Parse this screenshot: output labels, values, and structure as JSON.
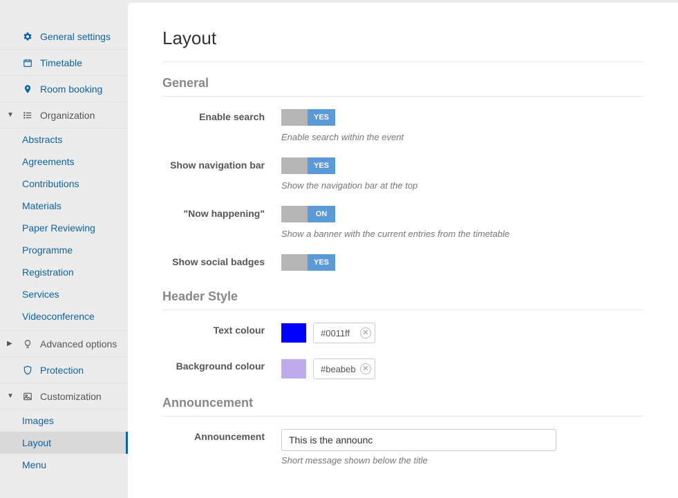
{
  "sidebar": {
    "general_settings": "General settings",
    "timetable": "Timetable",
    "room_booking": "Room booking",
    "organization": {
      "label": "Organization",
      "items": [
        "Abstracts",
        "Agreements",
        "Contributions",
        "Materials",
        "Paper Reviewing",
        "Programme",
        "Registration",
        "Services",
        "Videoconference"
      ]
    },
    "advanced_options": "Advanced options",
    "protection": "Protection",
    "customization": {
      "label": "Customization",
      "items": [
        "Images",
        "Layout",
        "Menu"
      ],
      "active": "Layout"
    }
  },
  "page": {
    "title": "Layout",
    "sections": {
      "general": {
        "heading": "General",
        "fields": {
          "enable_search": {
            "label": "Enable search",
            "toggle": "YES",
            "help": "Enable search within the event"
          },
          "show_nav": {
            "label": "Show navigation bar",
            "toggle": "YES",
            "help": "Show the navigation bar at the top"
          },
          "now_happening": {
            "label": "\"Now happening\"",
            "toggle": "ON",
            "help": "Show a banner with the current entries from the timetable"
          },
          "social_badges": {
            "label": "Show social badges",
            "toggle": "YES"
          }
        }
      },
      "header_style": {
        "heading": "Header Style",
        "fields": {
          "text_colour": {
            "label": "Text colour",
            "value": "#0011ff",
            "swatch": "#0000ff"
          },
          "bg_colour": {
            "label": "Background colour",
            "value": "#beabeb",
            "swatch": "#beabeb"
          }
        }
      },
      "announcement": {
        "heading": "Announcement",
        "fields": {
          "announcement": {
            "label": "Announcement",
            "value": "This is the announc",
            "help": "Short message shown below the title"
          }
        }
      }
    }
  }
}
